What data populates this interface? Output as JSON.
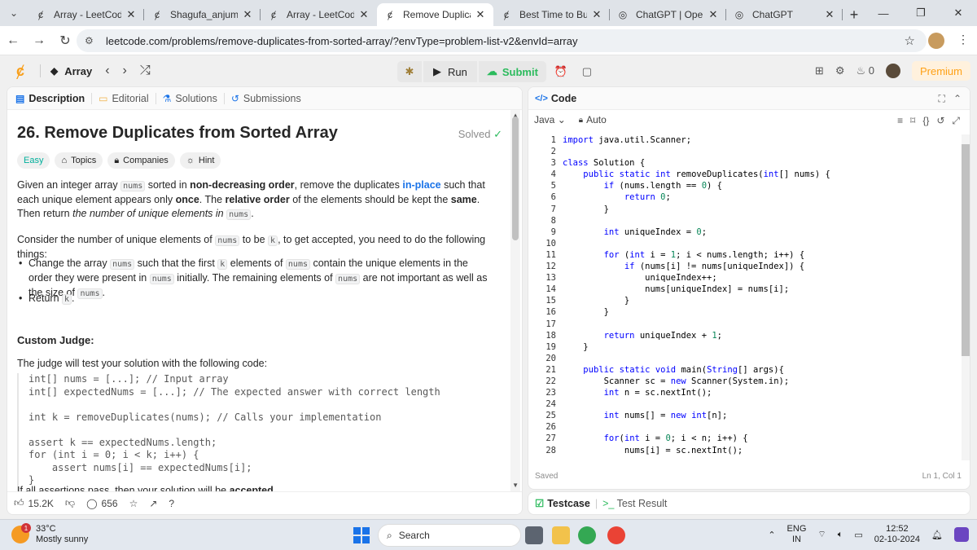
{
  "browser": {
    "tabs": [
      {
        "title": "Array - LeetCode",
        "active": false
      },
      {
        "title": "Shagufa_anjum - Lee",
        "active": false
      },
      {
        "title": "Array - LeetCode",
        "active": false
      },
      {
        "title": "Remove Duplicates f",
        "active": true
      },
      {
        "title": "Best Time to Buy and",
        "active": false
      },
      {
        "title": "ChatGPT | OpenAI",
        "active": false
      },
      {
        "title": "ChatGPT",
        "active": false
      }
    ],
    "url": "leetcode.com/problems/remove-duplicates-from-sorted-array/?envType=problem-list-v2&envId=array"
  },
  "header": {
    "list_name": "Array",
    "run_label": "Run",
    "submit_label": "Submit",
    "streak_count": "0",
    "premium_label": "Premium"
  },
  "left_tabs": [
    "Description",
    "Editorial",
    "Solutions",
    "Submissions"
  ],
  "problem": {
    "title": "26. Remove Duplicates from Sorted Array",
    "status": "Solved",
    "chips": [
      "Easy",
      "Topics",
      "Companies",
      "Hint"
    ],
    "custom_judge_heading": "Custom Judge:",
    "judge_text": "The judge will test your solution with the following code:",
    "judge_code": [
      "int[] nums = [...]; // Input array",
      "int[] expectedNums = [...]; // The expected answer with correct length",
      "",
      "int k = removeDuplicates(nums); // Calls your implementation",
      "",
      "assert k == expectedNums.length;",
      "for (int i = 0; i < k; i++) {",
      "    assert nums[i] == expectedNums[i];",
      "}"
    ],
    "footer_text": "If all assertions pass, then your solution will be",
    "footer_bold": "accepted"
  },
  "footer": {
    "likes": "15.2K",
    "comments": "656"
  },
  "code": {
    "heading": "Code",
    "language": "Java",
    "mode": "Auto",
    "saved": "Saved",
    "cursor": "Ln 1, Col 1",
    "lines": [
      "import java.util.Scanner;",
      "",
      "class Solution {",
      "    public static int removeDuplicates(int[] nums) {",
      "        if (nums.length == 0) {",
      "            return 0;",
      "        }",
      "",
      "        int uniqueIndex = 0;",
      "",
      "        for (int i = 1; i < nums.length; i++) {",
      "            if (nums[i] != nums[uniqueIndex]) {",
      "                uniqueIndex++;",
      "                nums[uniqueIndex] = nums[i];",
      "            }",
      "        }",
      "",
      "        return uniqueIndex + 1;",
      "    }",
      "",
      "    public static void main(String[] args){",
      "        Scanner sc = new Scanner(System.in);",
      "        int n = sc.nextInt();",
      "",
      "        int nums[] = new int[n];",
      "",
      "        for(int i = 0; i < n; i++) {",
      "            nums[i] = sc.nextInt();"
    ]
  },
  "bottom_tabs": [
    "Testcase",
    "Test Result"
  ],
  "taskbar": {
    "temperature": "33°C",
    "weather": "Mostly sunny",
    "weather_badge": "1",
    "search_placeholder": "Search",
    "lang": "ENG",
    "region": "IN",
    "time": "12:52",
    "date": "02-10-2024"
  }
}
